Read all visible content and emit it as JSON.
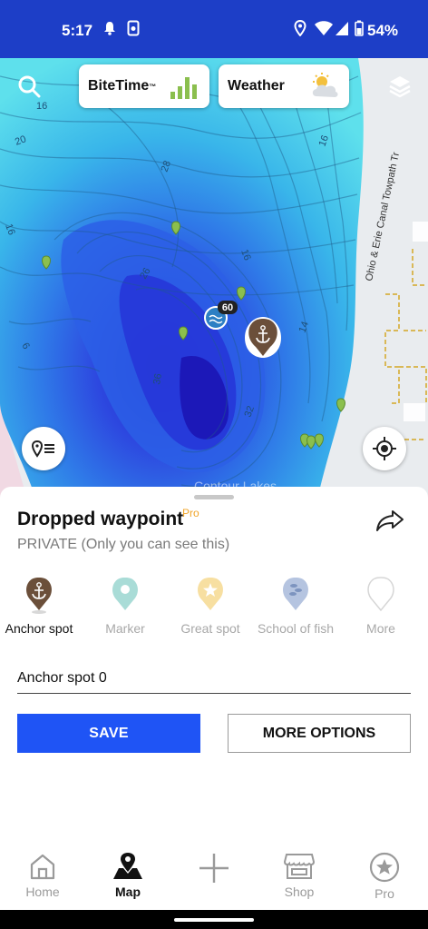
{
  "status": {
    "time": "5:17",
    "battery": "54%"
  },
  "map": {
    "bitetime_label": "BiteTime",
    "bitetime_tm": "™",
    "weather_label": "Weather",
    "depth_labels": [
      "20",
      "28",
      "16",
      "16",
      "26",
      "36",
      "16",
      "14",
      "32",
      "6",
      "16"
    ],
    "road_label": "Ohio & Erie Canal Towpath Tr",
    "spot_badge": "60",
    "watermark": "Contour Lakes"
  },
  "sheet": {
    "title": "Dropped waypoint",
    "pro_badge": "Pro",
    "privacy": "PRIVATE (Only you can see this)",
    "types": [
      {
        "label": "Anchor spot",
        "color": "#6b4f3a",
        "icon": "anchor-icon"
      },
      {
        "label": "Marker",
        "color": "#a9dcd7",
        "icon": "marker-icon"
      },
      {
        "label": "Great spot",
        "color": "#f7dfa1",
        "icon": "star-icon"
      },
      {
        "label": "School of fish",
        "color": "#b5c4e0",
        "icon": "fish-icon"
      },
      {
        "label": "More",
        "color": "#e6e6e6",
        "icon": "more-icon"
      }
    ],
    "name_value": "Anchor spot 0",
    "save_label": "SAVE",
    "more_options_label": "MORE OPTIONS"
  },
  "nav": {
    "items": [
      {
        "label": "Home"
      },
      {
        "label": "Map"
      },
      {
        "label": ""
      },
      {
        "label": "Shop"
      },
      {
        "label": "Pro"
      }
    ]
  },
  "colors": {
    "accent": "#1f54f5",
    "statusbar": "#1d3ec7",
    "pro": "#f0a52a",
    "anchor": "#6b4f3a"
  }
}
